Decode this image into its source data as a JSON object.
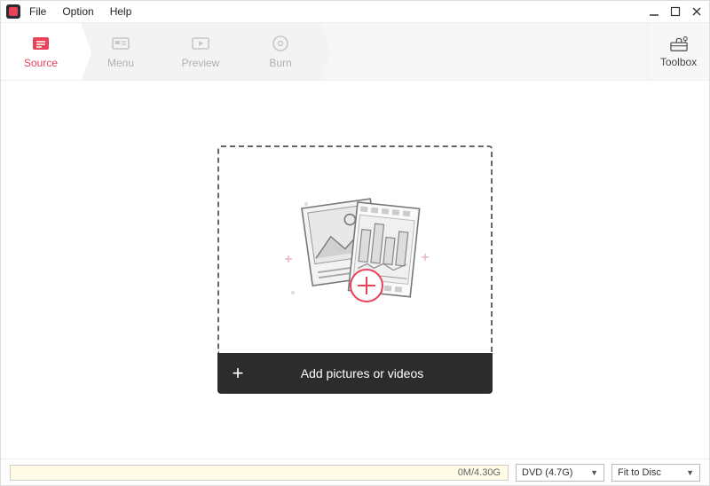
{
  "menu": {
    "file": "File",
    "option": "Option",
    "help": "Help"
  },
  "wizard": {
    "steps": [
      {
        "label": "Source",
        "active": true
      },
      {
        "label": "Menu",
        "active": false
      },
      {
        "label": "Preview",
        "active": false
      },
      {
        "label": "Burn",
        "active": false
      }
    ],
    "toolbox_label": "Toolbox"
  },
  "dropzone": {
    "add_label": "Add pictures or videos"
  },
  "bottom": {
    "progress_text": "0M/4.30G",
    "disc_type": "DVD (4.7G)",
    "fit_mode": "Fit to Disc"
  },
  "colors": {
    "accent": "#e84258"
  }
}
